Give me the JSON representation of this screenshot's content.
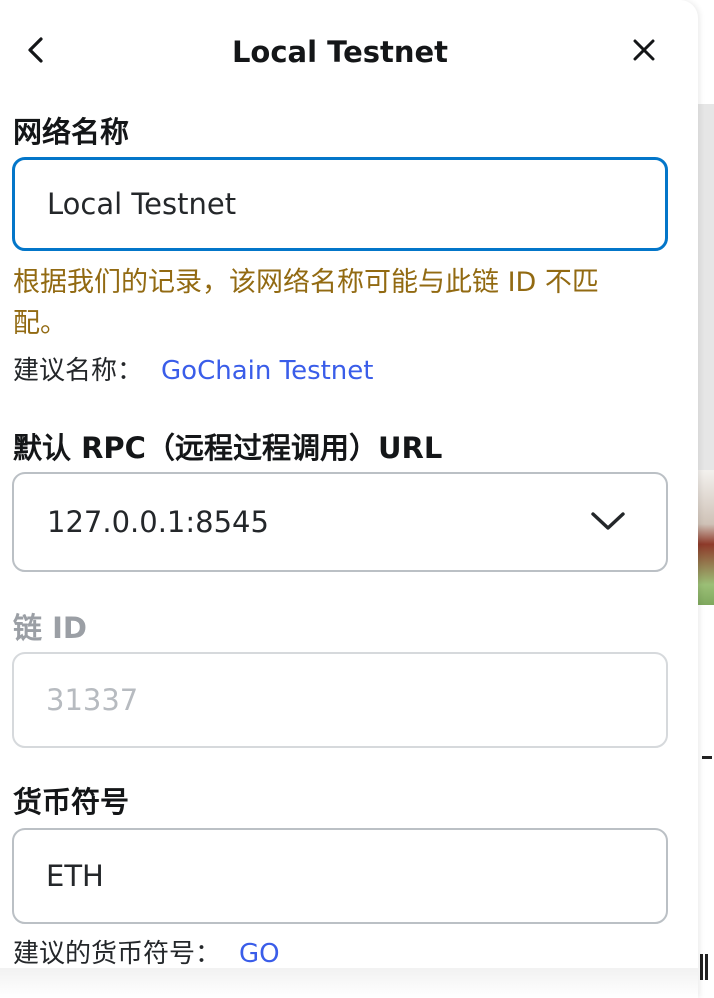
{
  "header": {
    "title": "Local Testnet"
  },
  "network_name": {
    "label": "网络名称",
    "value": "Local Testnet",
    "warning": "根据我们的记录，该网络名称可能与此链 ID 不匹配。",
    "suggest_label": "建议名称：",
    "suggest_value": "GoChain Testnet"
  },
  "rpc": {
    "label": "默认 RPC（远程过程调用）URL",
    "value": "127.0.0.1:8545"
  },
  "chain_id": {
    "label": "链 ID",
    "value": "31337"
  },
  "currency": {
    "label": "货币符号",
    "value": "ETH",
    "suggest_label": "建议的货币符号：",
    "suggest_value": "GO"
  },
  "colors": {
    "focus_border": "#0376c9",
    "warning_text": "#926a12",
    "link": "#3a5de9"
  }
}
